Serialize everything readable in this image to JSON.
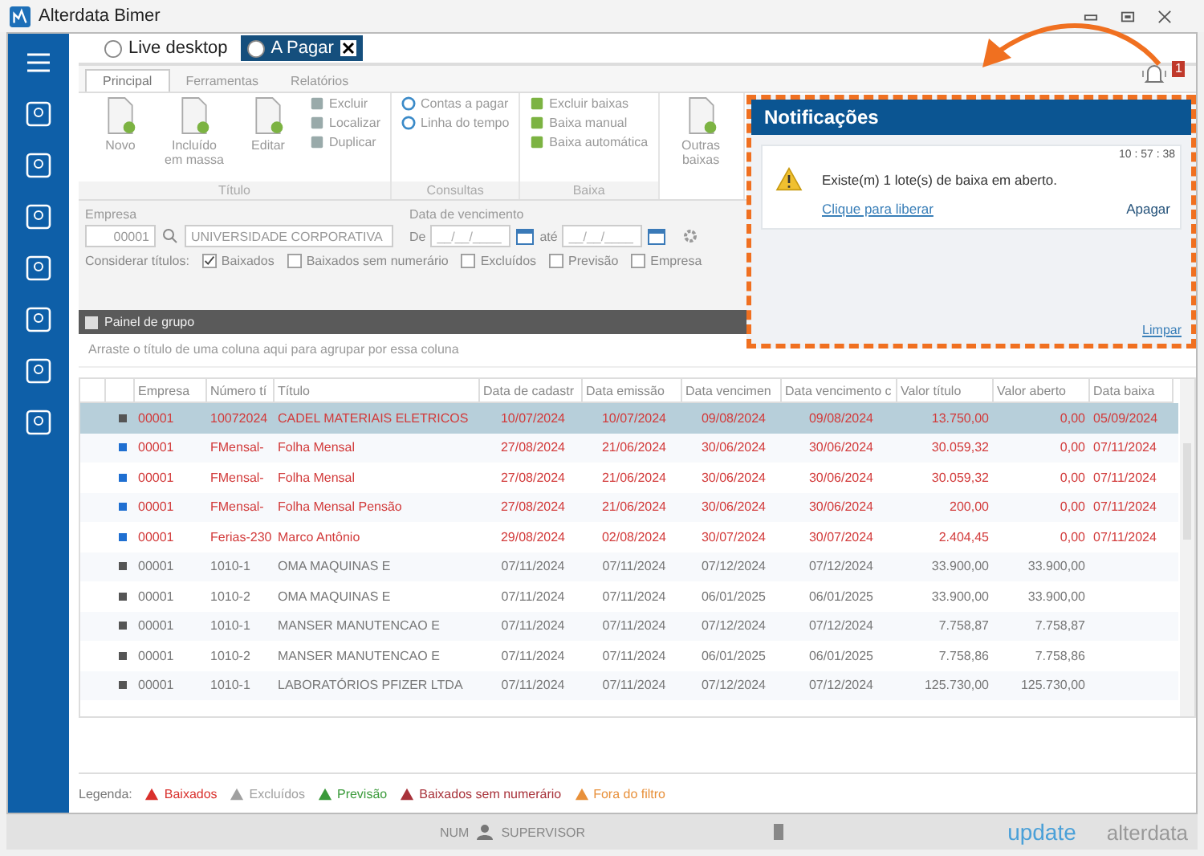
{
  "window": {
    "title": "Alterdata Bimer"
  },
  "doc_tabs": [
    {
      "label": "Live desktop",
      "selected": false,
      "closable": false
    },
    {
      "label": "A Pagar",
      "selected": true,
      "closable": true
    }
  ],
  "ribbon_tabs": [
    {
      "label": "Principal",
      "selected": true
    },
    {
      "label": "Ferramentas",
      "selected": false
    },
    {
      "label": "Relatórios",
      "selected": false
    }
  ],
  "ribbon_groups": [
    {
      "label": "Título",
      "large": [
        "Novo",
        "Incluído em massa",
        "Editar"
      ],
      "small": [
        "Excluir",
        "Localizar",
        "Duplicar"
      ]
    },
    {
      "label": "Consultas",
      "small": [
        "Contas a pagar",
        "Linha do tempo"
      ]
    },
    {
      "label": "Baixa",
      "small": [
        "Excluir baixas",
        "Baixa manual",
        "Baixa automática"
      ]
    },
    {
      "large": [
        "Outras baixas"
      ]
    }
  ],
  "filters": {
    "empresa_label": "Empresa",
    "empresa_code": "00001",
    "empresa_name": "UNIVERSIDADE CORPORATIVA",
    "date_label": "Data de vencimento",
    "from_label": "De",
    "from_placeholder": "__/__/____",
    "to_label": "até",
    "to_placeholder": "__/__/____",
    "consider_label": "Considerar títulos:",
    "options": [
      {
        "label": "Baixados",
        "checked": true
      },
      {
        "label": "Baixados sem numerário",
        "checked": false
      },
      {
        "label": "Excluídos",
        "checked": false
      },
      {
        "label": "Previsão",
        "checked": false
      },
      {
        "label": "Empresa",
        "checked": false
      }
    ]
  },
  "group_panel": {
    "title": "Painel de grupo",
    "hint": "Arraste o título de uma coluna aqui para agrupar por essa coluna"
  },
  "table": {
    "columns": [
      "Empresa",
      "Número tí",
      "Título",
      "Data de cadastr",
      "Data emissão",
      "Data vencimen",
      "Data vencimento c",
      "Valor título",
      "Valor aberto",
      "Data baixa"
    ],
    "rows": [
      {
        "selected": true,
        "kind": "baixado",
        "color": "#555555",
        "cells": [
          "00001",
          "10072024",
          "CADEL MATERIAIS ELETRICOS",
          "10/07/2024",
          "10/07/2024",
          "09/08/2024",
          "09/08/2024",
          "13.750,00",
          "0,00",
          "05/09/2024"
        ]
      },
      {
        "selected": false,
        "kind": "baixado",
        "color": "#1f6fd1",
        "cells": [
          "00001",
          "FMensal-",
          "Folha Mensal",
          "27/08/2024",
          "21/06/2024",
          "30/06/2024",
          "30/06/2024",
          "30.059,32",
          "0,00",
          "07/11/2024"
        ]
      },
      {
        "selected": false,
        "kind": "baixado",
        "color": "#1f6fd1",
        "cells": [
          "00001",
          "FMensal-",
          "Folha Mensal",
          "27/08/2024",
          "21/06/2024",
          "30/06/2024",
          "30/06/2024",
          "30.059,32",
          "0,00",
          "07/11/2024"
        ]
      },
      {
        "selected": false,
        "kind": "baixado",
        "color": "#1f6fd1",
        "cells": [
          "00001",
          "FMensal-",
          "Folha Mensal Pensão",
          "27/08/2024",
          "21/06/2024",
          "30/06/2024",
          "30/06/2024",
          "200,00",
          "0,00",
          "07/11/2024"
        ]
      },
      {
        "selected": false,
        "kind": "baixado",
        "color": "#1f6fd1",
        "cells": [
          "00001",
          "Ferias-230",
          "Marco Antônio",
          "29/08/2024",
          "02/08/2024",
          "30/07/2024",
          "30/07/2024",
          "2.404,45",
          "0,00",
          "07/11/2024"
        ]
      },
      {
        "selected": false,
        "kind": "aberto",
        "color": "#555555",
        "cells": [
          "00001",
          "1010-1",
          "OMA MAQUINAS E",
          "07/11/2024",
          "07/11/2024",
          "07/12/2024",
          "07/12/2024",
          "33.900,00",
          "33.900,00",
          ""
        ]
      },
      {
        "selected": false,
        "kind": "aberto",
        "color": "#555555",
        "cells": [
          "00001",
          "1010-2",
          "OMA MAQUINAS E",
          "07/11/2024",
          "07/11/2024",
          "06/01/2025",
          "06/01/2025",
          "33.900,00",
          "33.900,00",
          ""
        ]
      },
      {
        "selected": false,
        "kind": "aberto",
        "color": "#555555",
        "cells": [
          "00001",
          "1010-1",
          "MANSER MANUTENCAO E",
          "07/11/2024",
          "07/11/2024",
          "07/12/2024",
          "07/12/2024",
          "7.758,87",
          "7.758,87",
          ""
        ]
      },
      {
        "selected": false,
        "kind": "aberto",
        "color": "#555555",
        "cells": [
          "00001",
          "1010-2",
          "MANSER MANUTENCAO E",
          "07/11/2024",
          "07/11/2024",
          "06/01/2025",
          "06/01/2025",
          "7.758,86",
          "7.758,86",
          ""
        ]
      },
      {
        "selected": false,
        "kind": "aberto",
        "color": "#555555",
        "cells": [
          "00001",
          "1010-1",
          "LABORATÓRIOS PFIZER LTDA",
          "07/11/2024",
          "07/11/2024",
          "07/12/2024",
          "07/12/2024",
          "125.730,00",
          "125.730,00",
          ""
        ]
      }
    ]
  },
  "legend": {
    "label": "Legenda:",
    "items": [
      {
        "label": "Baixados",
        "color": "#d9302c"
      },
      {
        "label": "Excluídos",
        "color": "#a0a0a0"
      },
      {
        "label": "Previsão",
        "color": "#3a9a3a"
      },
      {
        "label": "Baixados sem numerário",
        "color": "#a8323a"
      },
      {
        "label": "Fora do filtro",
        "color": "#e8903a"
      }
    ]
  },
  "status_bar": {
    "num": "NUM",
    "user": "SUPERVISOR",
    "update": "update",
    "brand": "alterdata"
  },
  "notifications": {
    "badge": "1",
    "title": "Notificações",
    "items": [
      {
        "time": "10 : 57 : 38",
        "message": "Existe(m) 1 lote(s) de baixa em aberto.",
        "link": "Clique para liberar",
        "action": "Apagar"
      }
    ],
    "clear": "Limpar"
  }
}
